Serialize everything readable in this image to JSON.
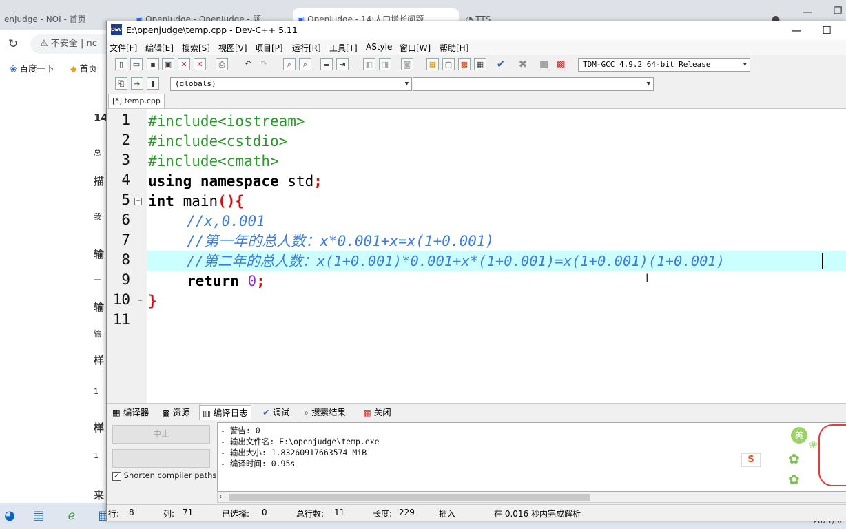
{
  "browser": {
    "tabs": [
      "enJudge - NOI - 首页",
      "OpenJudge - OpenJudge - 题",
      "OpenJudge - 14:人口增长问题",
      "TTS"
    ],
    "security_label": "不安全",
    "url_fragment": "nc",
    "bookmarks": [
      "百度一下",
      "首页"
    ],
    "page_chars": [
      "14",
      "总",
      "描",
      "我",
      "输",
      "一",
      "输",
      "输",
      "样",
      "1",
      "样",
      "1",
      "来"
    ]
  },
  "window": {
    "title": "E:\\openjudge\\temp.cpp - Dev-C++ 5.11",
    "icon_text": "DEV",
    "minimize": "—",
    "maximize": "☐"
  },
  "menu": [
    "文件[F]",
    "编辑[E]",
    "搜索[S]",
    "视图[V]",
    "项目[P]",
    "运行[R]",
    "工具[T]",
    "AStyle",
    "窗口[W]",
    "帮助[H]"
  ],
  "toolbar": {
    "compiler": "TDM-GCC 4.9.2 64-bit Release",
    "scope": "(globals)",
    "symbol": ""
  },
  "file_tab": "[*] temp.cpp",
  "editor": {
    "line_numbers": [
      "1",
      "2",
      "3",
      "4",
      "5",
      "6",
      "7",
      "8",
      "9",
      "10",
      "11"
    ],
    "lines": {
      "l1": "#include<iostream>",
      "l2": "#include<cstdio>",
      "l3": "#include<cmath>",
      "l4_kw1": "using",
      "l4_kw2": "namespace",
      "l4_rest": " std",
      "l4_semi": ";",
      "l5_kw": "int",
      "l5_rest": " main",
      "l5_paren": "(){",
      "l6": "//x,0.001",
      "l7": "//第一年的总人数：x*0.001+x=x(1+0.001)",
      "l8": "//第二年的总人数：x(1+0.001)*0.001+x*(1+0.001)=x(1+0.001)(1+0.001)",
      "l9_kw": "return",
      "l9_num": "0",
      "l9_semi": ";",
      "l10": "}"
    }
  },
  "bottom_tabs": [
    "编译器",
    "资源",
    "编译日志",
    "调试",
    "搜索结果",
    "关闭"
  ],
  "bottom_panel": {
    "stop_button": "中止",
    "shorten_label": "Shorten compiler paths",
    "shorten_checked": true,
    "log": [
      "- 警告: 0",
      "- 输出文件名: E:\\openjudge\\temp.exe",
      "- 输出大小: 1.83260917663574 MiB",
      "- 编译时间: 0.95s"
    ]
  },
  "status": {
    "row_label": "行:",
    "row": "8",
    "col_label": "列:",
    "col": "71",
    "sel_label": "已选择:",
    "sel": "0",
    "total_label": "总行数:",
    "total": "11",
    "len_label": "长度:",
    "len": "229",
    "mode": "插入",
    "parse": "在 0.016 秒内完成解析"
  },
  "taskbar": {
    "clock_fragment": "2021/5/"
  },
  "ime": {
    "label": "英",
    "sogou": "S"
  },
  "colors": {
    "preprocessor": "#2a9a2a",
    "comment": "#3b7de0",
    "brace": "#d01010",
    "number": "#8a2be2",
    "current_line": "#ccffff"
  }
}
